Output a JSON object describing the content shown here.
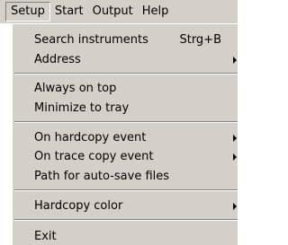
{
  "menubar": {
    "items": [
      {
        "label": "Setup"
      },
      {
        "label": "Start"
      },
      {
        "label": "Output"
      },
      {
        "label": "Help"
      }
    ]
  },
  "setup_menu": {
    "items": [
      {
        "label": "Search instruments",
        "shortcut": "Strg+B"
      },
      {
        "label": "Address",
        "submenu": true
      },
      {
        "label": "Always on top"
      },
      {
        "label": "Minimize to tray"
      },
      {
        "label": "On hardcopy event",
        "submenu": true
      },
      {
        "label": "On trace copy event",
        "submenu": true
      },
      {
        "label": "Path for auto-save files"
      },
      {
        "label": "Hardcopy color",
        "submenu": true
      },
      {
        "label": "Exit"
      }
    ]
  },
  "icons": {
    "submenu_arrow": "chevron-right-icon"
  }
}
